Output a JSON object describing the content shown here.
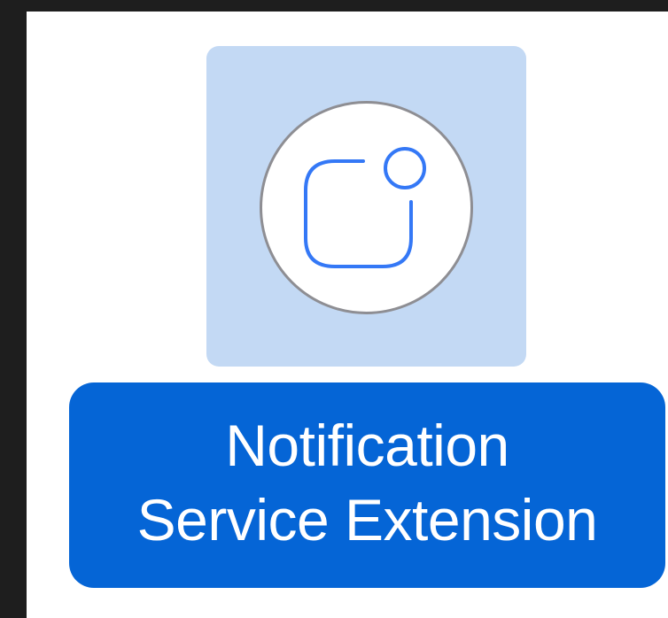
{
  "item": {
    "icon": "notification-badge-icon",
    "label_line_1": "Notification",
    "label_line_2": "Service Extension",
    "selected": true
  },
  "colors": {
    "background": "#1e1e1e",
    "panel": "#ffffff",
    "tile_selected": "#c3d9f4",
    "icon_stroke": "#3478f6",
    "icon_ring": "#8e8e93",
    "label_selected": "#0565d6",
    "label_text": "#ffffff"
  }
}
